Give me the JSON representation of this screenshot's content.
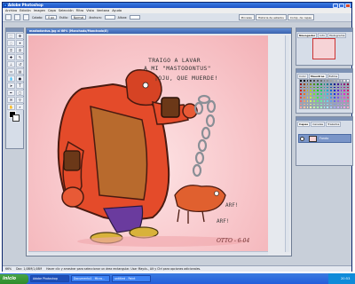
{
  "window": {
    "title": "Adobe Photoshop"
  },
  "menu": [
    "Archivo",
    "Edición",
    "Imagen",
    "Capa",
    "Selección",
    "Filtro",
    "Vista",
    "Ventana",
    "Ayuda"
  ],
  "options": {
    "calado_label": "Calado:",
    "calado_value": "0 px",
    "estilo_label": "Estilo:",
    "estilo_value": "Normal",
    "anchura_label": "Anchura:",
    "altura_label": "Altura:"
  },
  "palette_well": [
    "Pinceles",
    "Historia de estados",
    "Comp. de capas"
  ],
  "document": {
    "title": "mastodontus.jpg al 66% (Manchado/Manchado/8)",
    "caption_line1": "TRAIGO A LAVAR",
    "caption_line2": "A MI \"MASTODONTUS\"",
    "caption_line3": "¡OJU, QUE MUERDE!",
    "arf1": "ARF!",
    "arf2": "ARF!",
    "signature": "OTTO - 6-04"
  },
  "panels": {
    "navigator_tabs": [
      "Navegador",
      "Info",
      "Histograma"
    ],
    "color_tabs": [
      "Color",
      "Muestras",
      "Estilos"
    ],
    "layer_tabs": [
      "Capas",
      "Canales",
      "Trazados"
    ],
    "layer_name": "Fondo"
  },
  "status": {
    "zoom": "66%",
    "doc": "Doc: 1,08M/1,08M",
    "hint": "Hacer clic y arrastrar para seleccionar un área rectangular. Usar Mayús., Alt y Ctrl para opciones adicionales."
  },
  "taskbar": {
    "start": "inicio",
    "tasks": [
      "Adobe Photoshop",
      "Documento1 - Micro...",
      "untitled - Paint"
    ],
    "time": "20:53"
  },
  "colors": {
    "accent": "#245edb",
    "canvas_bg": "#f8c7cb",
    "character_shirt": "#e44b2a",
    "dog": "#e0602f"
  }
}
